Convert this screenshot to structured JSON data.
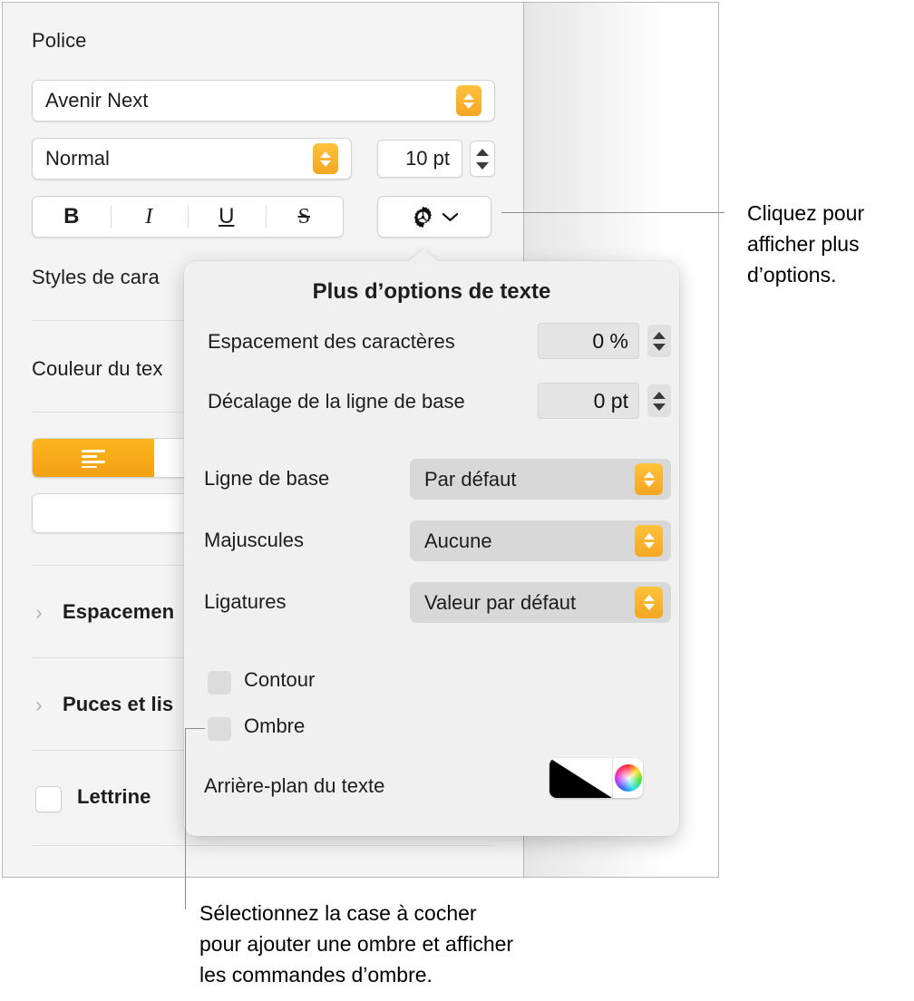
{
  "panel": {
    "font_section_title": "Police",
    "font_family_value": "Avenir Next",
    "font_style_value": "Normal",
    "font_size_value": "10 pt",
    "bold_label": "B",
    "italic_label": "I",
    "underline_label": "U",
    "strikethrough_label": "S",
    "gear_icon": "gear-icon",
    "gear_chevron": "chevron-down-icon",
    "character_styles_title": "Styles de cara",
    "text_color_title": "Couleur du tex",
    "align_left_icon": "align-left-icon",
    "align_indent_icon": "text-direction-rtl-icon",
    "spacing_title": "Espacemen",
    "bullets_title": "Puces et lis",
    "dropcap_label": "Lettrine",
    "disclosure_icon": "chevron-right-icon"
  },
  "popover": {
    "title": "Plus d’options de texte",
    "character_spacing_label": "Espacement des caractères",
    "character_spacing_value": "0 %",
    "baseline_shift_label": "Décalage de la ligne de base",
    "baseline_shift_value": "0 pt",
    "baseline_label": "Ligne de base",
    "baseline_value": "Par défaut",
    "capitalization_label": "Majuscules",
    "capitalization_value": "Aucune",
    "ligatures_label": "Ligatures",
    "ligatures_value": "Valeur par défaut",
    "outline_label": "Contour",
    "shadow_label": "Ombre",
    "text_background_label": "Arrière-plan du texte",
    "color_well_icon": "color-swatch",
    "color_wheel_icon": "color-wheel-icon"
  },
  "callouts": {
    "gear": "Cliquez pour afficher plus d’options.",
    "shadow_line1": "Sélectionnez la case à cocher",
    "shadow_line2": "pour ajouter une ombre et afficher",
    "shadow_line3": "les commandes d’ombre."
  },
  "colors": {
    "accent_orange": "#f5a623",
    "panel_background": "#f4f4f4",
    "popover_background": "#f0f0f0",
    "leader_line": "#8c8c8c"
  }
}
